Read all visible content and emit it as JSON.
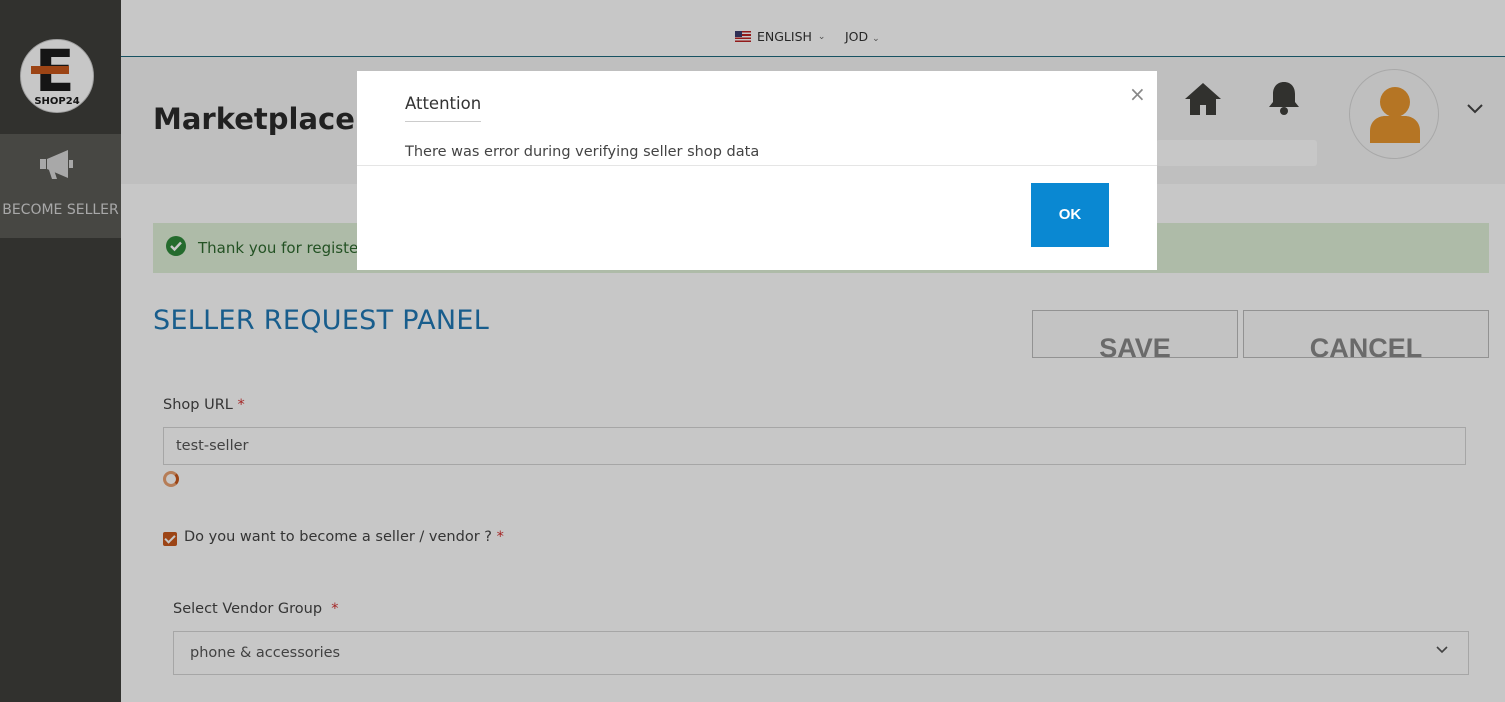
{
  "sidebar": {
    "logo_text": "SHOP24",
    "logo_letter": "E",
    "items": [
      {
        "label": "BECOME SELLER",
        "icon": "megaphone-icon"
      }
    ]
  },
  "topbar": {
    "language": "ENGLISH",
    "currency": "JOD"
  },
  "header": {
    "title": "Marketplace E"
  },
  "alert": {
    "text": "Thank you for registerin"
  },
  "panel": {
    "title": "SELLER REQUEST PANEL",
    "save_label": "SAVE",
    "cancel_label": "CANCEL"
  },
  "form": {
    "shop_url_label": "Shop URL",
    "shop_url_value": "test-seller",
    "required_mark": "*",
    "become_seller_label": "Do you want to become a seller / vendor ?",
    "become_seller_checked": true,
    "vendor_group_label": "Select Vendor Group",
    "vendor_group_value": "phone & accessories"
  },
  "modal": {
    "title": "Attention",
    "message": "There was error during verifying seller shop data",
    "ok_label": "OK",
    "close_glyph": "×"
  },
  "colors": {
    "sidebar_bg": "#3f3f3b",
    "accent_orange": "#c8581c",
    "ok_button": "#0a88d2",
    "panel_title": "#1f78b4",
    "alert_bg": "#dff0d8"
  }
}
